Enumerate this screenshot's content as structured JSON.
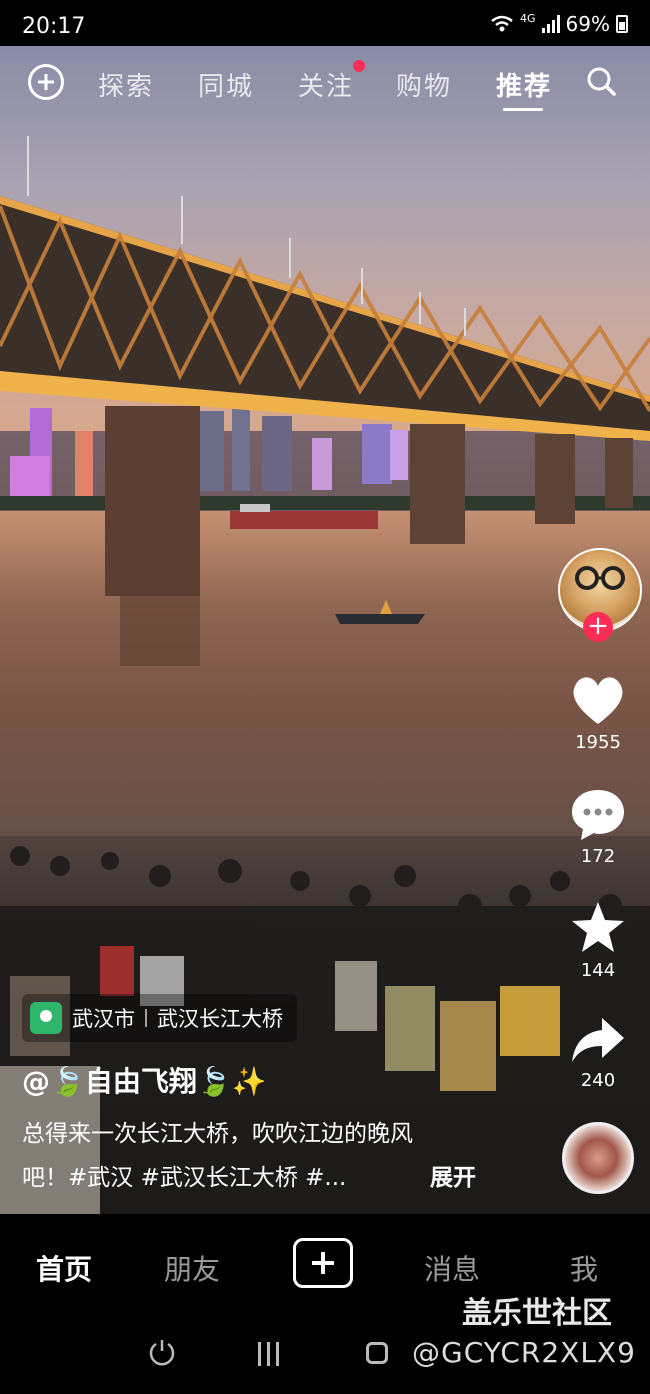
{
  "status_bar": {
    "time": "20:17",
    "network": "4G",
    "battery": "69%"
  },
  "top_nav": {
    "tabs": [
      {
        "label": "探索"
      },
      {
        "label": "同城"
      },
      {
        "label": "关注",
        "has_dot": true
      },
      {
        "label": "购物"
      },
      {
        "label": "推荐",
        "active": true
      }
    ]
  },
  "rail": {
    "likes": "1955",
    "comments": "172",
    "favorites": "144",
    "shares": "240"
  },
  "location": {
    "city": "武汉市",
    "place": "武汉长江大桥"
  },
  "post": {
    "author": "@🍃自由飞翔🍃✨",
    "caption_line1": "总得来一次长江大桥，吹吹江边的晚风",
    "caption_line2": "吧！#武汉 #武汉长江大桥 #...",
    "expand_label": "展开"
  },
  "bottom_nav": {
    "home": "首页",
    "friends": "朋友",
    "messages": "消息",
    "me": "我"
  },
  "watermark": {
    "line1": "盖乐世社区",
    "line2": "@GCYCR2XLX9"
  },
  "colors": {
    "accent": "#ff2d55",
    "location_pin": "#2fb66b"
  }
}
